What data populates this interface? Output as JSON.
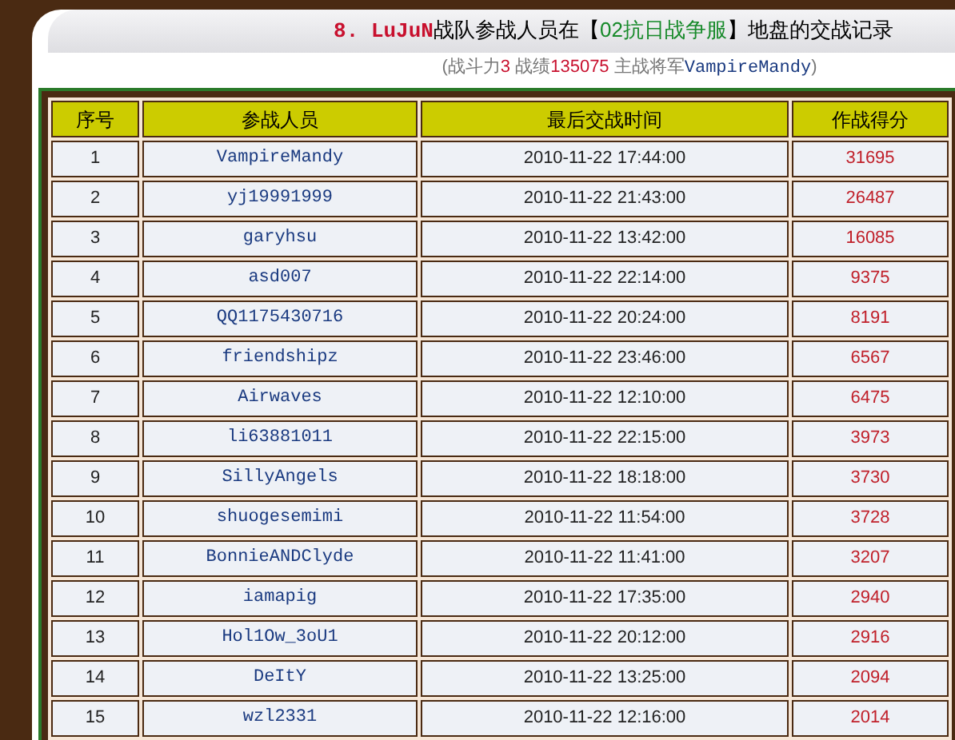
{
  "title": {
    "rank": "8. LuJuN",
    "text_before": "战队参战人员在【",
    "server": "02抗日战争服",
    "text_after": "】地盘的交战记录"
  },
  "summary": {
    "power_label": "(战斗力",
    "power": "3",
    "record_label": " 战绩",
    "record": "135075",
    "general_label": " 主战将军",
    "general": "VampireMandy",
    "close": ")"
  },
  "table": {
    "columns": [
      "序号",
      "参战人员",
      "最后交战时间",
      "作战得分"
    ],
    "rows": [
      [
        "1",
        "VampireMandy",
        "2010-11-22 17:44:00",
        "31695"
      ],
      [
        "2",
        "yj19991999",
        "2010-11-22 21:43:00",
        "26487"
      ],
      [
        "3",
        "garyhsu",
        "2010-11-22 13:42:00",
        "16085"
      ],
      [
        "4",
        "asd007",
        "2010-11-22 22:14:00",
        "9375"
      ],
      [
        "5",
        "QQ1175430716",
        "2010-11-22 20:24:00",
        "8191"
      ],
      [
        "6",
        "friendshipz",
        "2010-11-22 23:46:00",
        "6567"
      ],
      [
        "7",
        "Airwaves",
        "2010-11-22 12:10:00",
        "6475"
      ],
      [
        "8",
        "li63881011",
        "2010-11-22 22:15:00",
        "3973"
      ],
      [
        "9",
        "SillyAngels",
        "2010-11-22 18:18:00",
        "3730"
      ],
      [
        "10",
        "shuogesemimi",
        "2010-11-22 11:54:00",
        "3728"
      ],
      [
        "11",
        "BonnieANDClyde",
        "2010-11-22 11:41:00",
        "3207"
      ],
      [
        "12",
        "iamapig",
        "2010-11-22 17:35:00",
        "2940"
      ],
      [
        "13",
        "Hol1Ow_3oU1",
        "2010-11-22 20:12:00",
        "2916"
      ],
      [
        "14",
        "DeItY",
        "2010-11-22 13:25:00",
        "2094"
      ],
      [
        "15",
        "wzl2331",
        "2010-11-22 12:16:00",
        "2014"
      ]
    ]
  }
}
